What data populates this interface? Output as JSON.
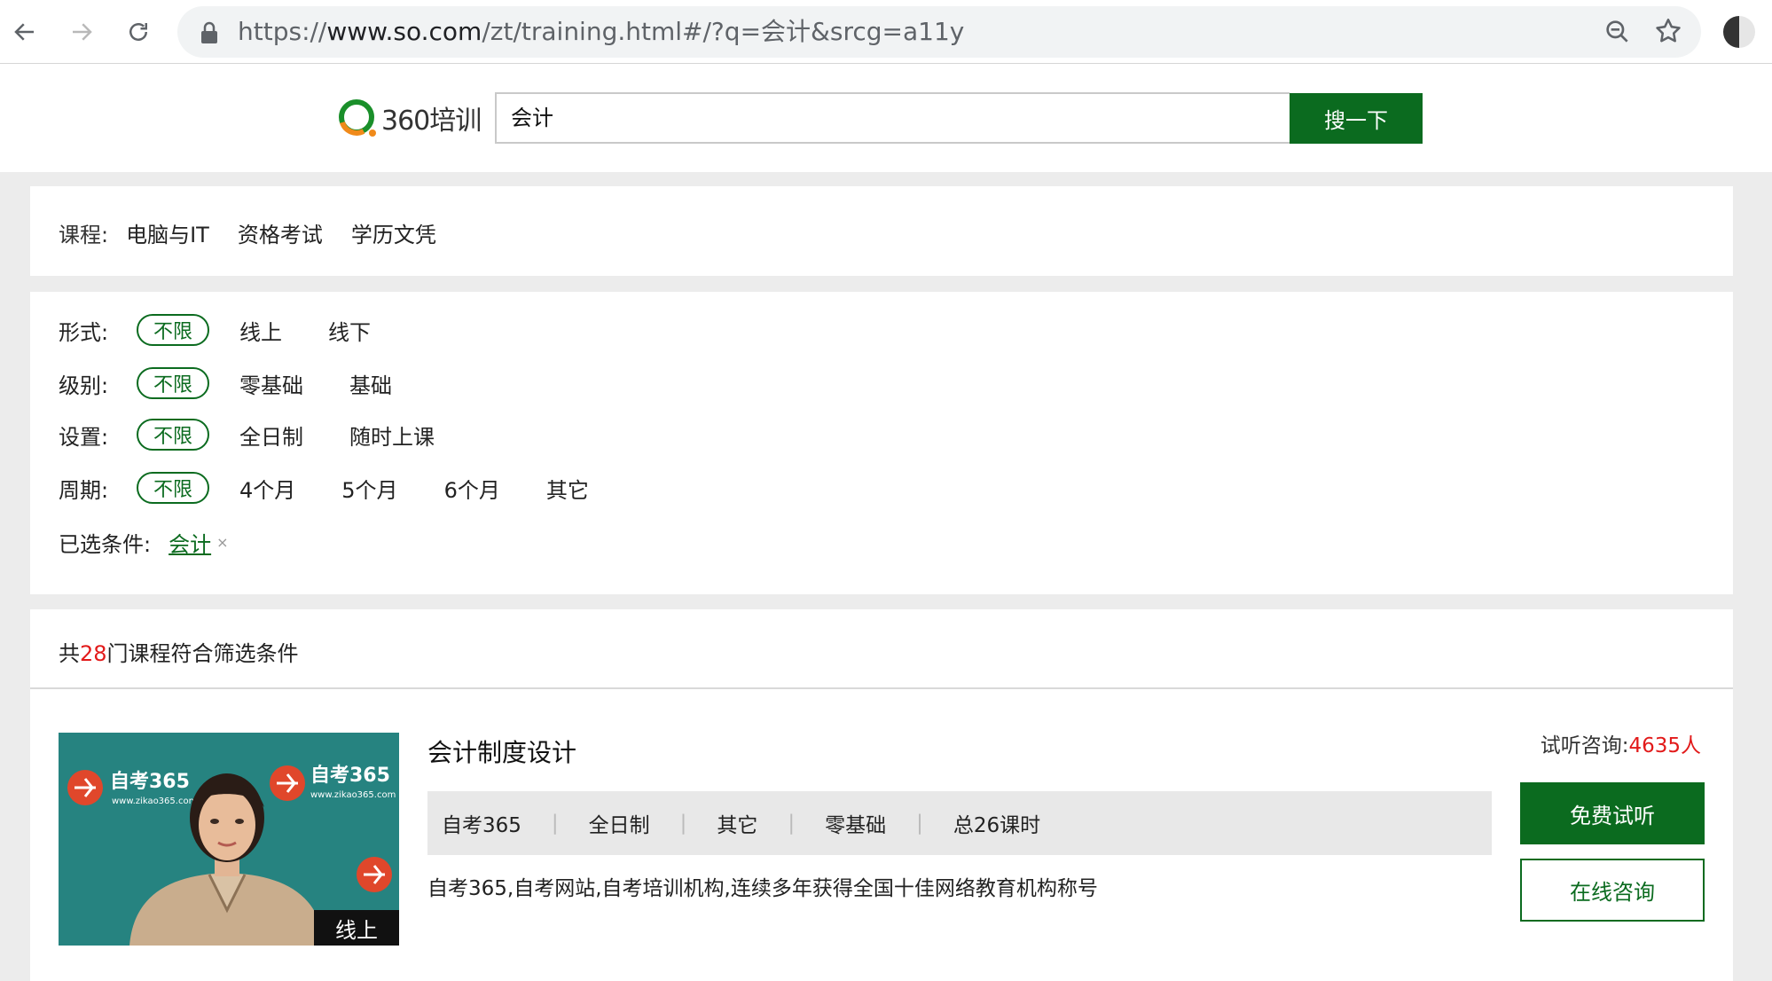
{
  "browser": {
    "url_scheme": "https://",
    "url_host": "www.so.com",
    "url_path": "/zt/training.html#/?q=会计&srcg=a11y"
  },
  "header": {
    "logo_text": "360培训",
    "search_value": "会计",
    "search_button": "搜一下"
  },
  "courses": {
    "label": "课程:",
    "items": [
      "电脑与IT",
      "资格考试",
      "学历文凭"
    ]
  },
  "filters": {
    "format": {
      "label": "形式:",
      "all": "不限",
      "options": [
        "线上",
        "线下"
      ]
    },
    "level": {
      "label": "级别:",
      "all": "不限",
      "options": [
        "零基础",
        "基础"
      ]
    },
    "setting": {
      "label": "设置:",
      "all": "不限",
      "options": [
        "全日制",
        "随时上课"
      ]
    },
    "period": {
      "label": "周期:",
      "all": "不限",
      "options": [
        "4个月",
        "5个月",
        "6个月",
        "其它"
      ]
    },
    "selected": {
      "label": "已选条件:",
      "tag": "会计",
      "remove": "×"
    }
  },
  "results": {
    "prefix": "共",
    "count": "28",
    "suffix": "门课程符合筛选条件"
  },
  "course_card": {
    "badge": "线上",
    "title": "会计制度设计",
    "meta": [
      "自考365",
      "全日制",
      "其它",
      "零基础",
      "总26课时"
    ],
    "separator": "|",
    "desc": "自考365,自考网站,自考培训机构,连续多年获得全国十佳网络教育机构称号",
    "consult_label": "试听咨询:",
    "consult_count": "4635人",
    "trial_button": "免费试听",
    "online_button": "在线咨询",
    "thumb_brand": "自考365",
    "thumb_site": "www.zikao365.com"
  },
  "colors": {
    "brand_green": "#0b6b1f",
    "accent_red": "#e21a1a"
  }
}
